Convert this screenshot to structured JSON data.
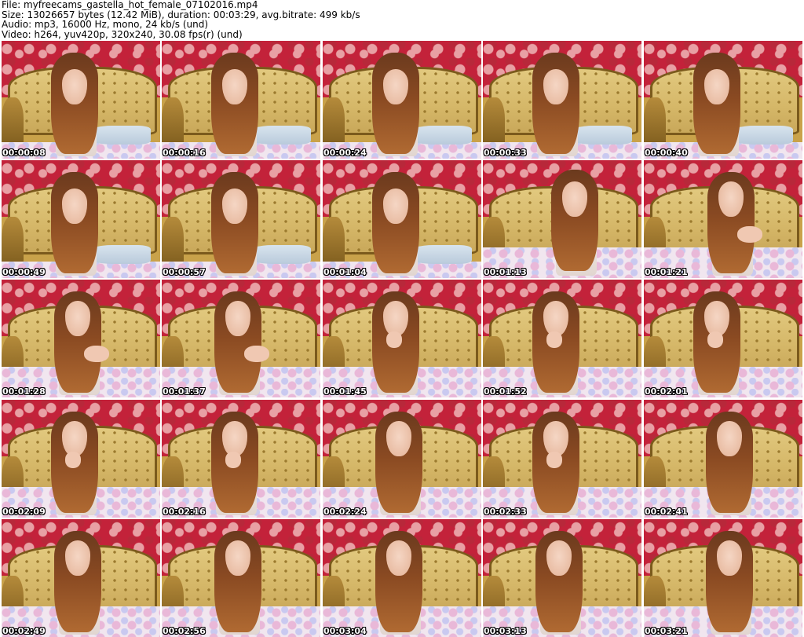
{
  "header": {
    "file_line": "File: myfreecams_gastella_hot_female_07102016.mp4",
    "size_line": "Size: 13026657 bytes (12.42 MiB), duration: 00:03:29, avg.bitrate: 499 kb/s",
    "audio_line": "Audio: mp3, 16000 Hz, mono, 24 kb/s (und)",
    "video_line": "Video: h264, yuv420p, 320x240, 30.08 fps(r) (und)"
  },
  "thumbnails": [
    {
      "time": "00:00:08",
      "pose": "lying"
    },
    {
      "time": "00:00:16",
      "pose": "lying"
    },
    {
      "time": "00:00:24",
      "pose": "lying"
    },
    {
      "time": "00:00:33",
      "pose": "lying"
    },
    {
      "time": "00:00:40",
      "pose": "lying"
    },
    {
      "time": "00:00:49",
      "pose": "lying"
    },
    {
      "time": "00:00:57",
      "pose": "lying"
    },
    {
      "time": "00:01:04",
      "pose": "lying"
    },
    {
      "time": "00:01:13",
      "pose": "kneeling"
    },
    {
      "time": "00:01:21",
      "pose": "hands"
    },
    {
      "time": "00:01:28",
      "pose": "hands"
    },
    {
      "time": "00:01:37",
      "pose": "hands"
    },
    {
      "time": "00:01:45",
      "pose": "chin"
    },
    {
      "time": "00:01:52",
      "pose": "chin"
    },
    {
      "time": "00:02:01",
      "pose": "chin"
    },
    {
      "time": "00:02:09",
      "pose": "chin"
    },
    {
      "time": "00:02:16",
      "pose": "chin"
    },
    {
      "time": "00:02:24",
      "pose": "sitting"
    },
    {
      "time": "00:02:33",
      "pose": "chin"
    },
    {
      "time": "00:02:41",
      "pose": "sitting"
    },
    {
      "time": "00:02:49",
      "pose": "sitting"
    },
    {
      "time": "00:02:56",
      "pose": "sitting"
    },
    {
      "time": "00:03:04",
      "pose": "sitting"
    },
    {
      "time": "00:03:13",
      "pose": "sitting"
    },
    {
      "time": "00:03:21",
      "pose": "sitting"
    }
  ],
  "colors": {
    "wallpaper": "#c3223a",
    "sofa": "#d5b768",
    "hair": "#8a4a22",
    "timestamp_text": "#ffffff"
  }
}
